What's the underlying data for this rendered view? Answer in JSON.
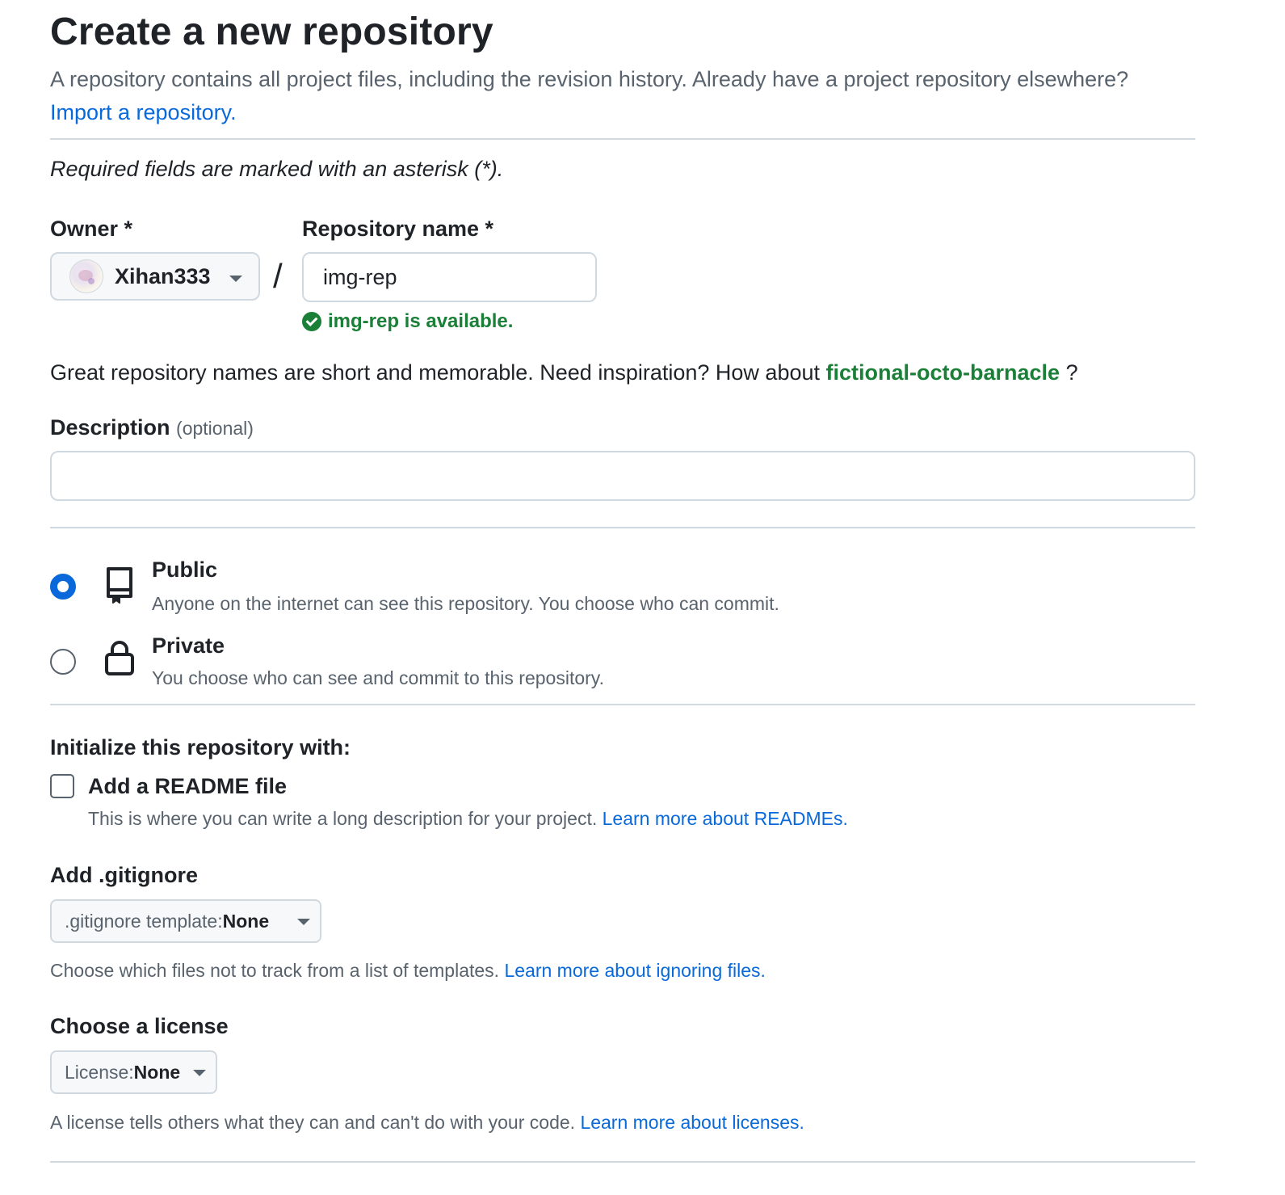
{
  "header": {
    "title": "Create a new repository",
    "subtitle": "A repository contains all project files, including the revision history. Already have a project repository elsewhere?",
    "import_link": "Import a repository."
  },
  "required_note": "Required fields are marked with an asterisk (*).",
  "owner": {
    "label": "Owner *",
    "value": "Xihan333"
  },
  "slash": "/",
  "repo_name": {
    "label": "Repository name *",
    "value": "img-rep",
    "availability": "img-rep is available."
  },
  "inspiration": {
    "text": "Great repository names are short and memorable. Need inspiration? How about",
    "suggestion": "fictional-octo-barnacle",
    "suffix": "?"
  },
  "description": {
    "label": "Description",
    "optional": "(optional)",
    "value": ""
  },
  "visibility": {
    "selected": "public",
    "options": [
      {
        "title": "Public",
        "desc": "Anyone on the internet can see this repository. You choose who can commit."
      },
      {
        "title": "Private",
        "desc": "You choose who can see and commit to this repository."
      }
    ]
  },
  "initialize": {
    "heading": "Initialize this repository with:",
    "readme_label": "Add a README file",
    "readme_checked": false,
    "readme_desc": "This is where you can write a long description for your project.",
    "readme_link": "Learn more about READMEs."
  },
  "gitignore": {
    "heading": "Add .gitignore",
    "prefix": ".gitignore template:",
    "value": "None",
    "help": "Choose which files not to track from a list of templates.",
    "help_link": "Learn more about ignoring files."
  },
  "license": {
    "heading": "Choose a license",
    "prefix": "License:",
    "value": "None",
    "help": "A license tells others what they can and can't do with your code.",
    "help_link": "Learn more about licenses."
  },
  "colors": {
    "accent": "#0969da",
    "success": "#1a7f37",
    "muted": "#59636e",
    "border": "#d1d9e0"
  },
  "icons": {
    "owner_caret": "triangle-down-icon",
    "availability": "check-circle-fill-icon",
    "public": "repo-icon",
    "private": "lock-icon"
  }
}
